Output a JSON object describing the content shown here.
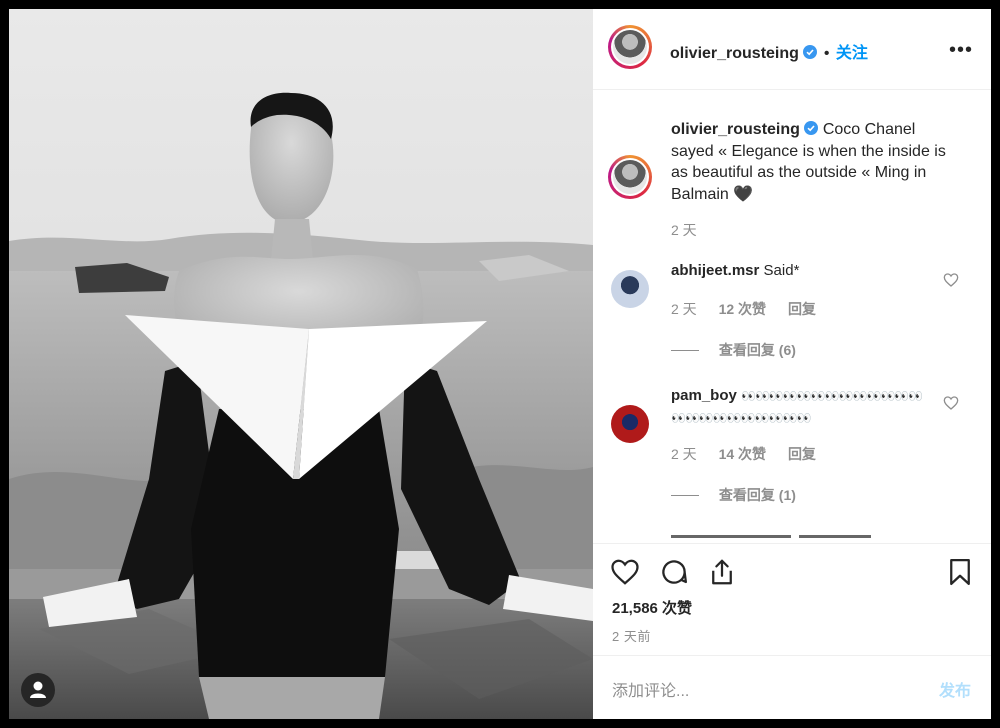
{
  "post": {
    "username": "olivier_rousteing",
    "follow_label": "关注",
    "caption": "Coco Chanel sayed « Elegance is when the inside is as beautiful as the outside « Ming in Balmain",
    "caption_emoji": "🖤",
    "caption_age": "2 天"
  },
  "comments": [
    {
      "username": "abhijeet.msr",
      "text": "Said*",
      "age": "2 天",
      "likes": "12 次赞",
      "reply_label": "回复",
      "view_replies": "查看回复 (6)"
    },
    {
      "username": "pam_boy",
      "text": "👀👀👀👀👀👀👀👀👀👀👀👀👀👀👀👀👀👀👀👀👀👀👀",
      "age": "2 天",
      "likes": "14 次赞",
      "reply_label": "回复",
      "view_replies": "查看回复 (1)"
    }
  ],
  "footer": {
    "likes": "21,586 次赞",
    "time": "2 天前",
    "comment_placeholder": "添加评论...",
    "post_label": "发布"
  },
  "colors": {
    "accent": "#0095f6",
    "verified": "#3897f0",
    "muted": "#8e8e8e",
    "text": "#262626"
  },
  "icons": [
    "verified-badge-icon",
    "more-options-icon",
    "heart-icon",
    "comment-icon",
    "share-icon",
    "bookmark-icon",
    "user-icon"
  ]
}
